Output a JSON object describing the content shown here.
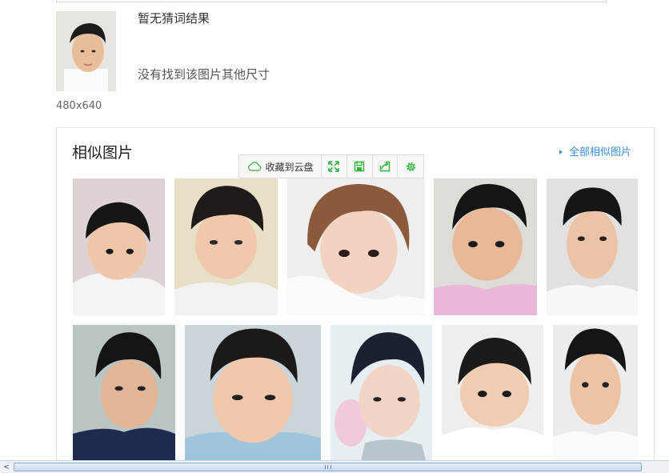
{
  "query": {
    "guess_text": "暂无猜词结果",
    "no_size_text": "没有找到该图片其他尺寸",
    "size": "480x640"
  },
  "similar": {
    "title": "相似图片",
    "all_link": "全部相似图片"
  },
  "toolbar": {
    "save_label": "收藏到云盘",
    "icons": [
      "fullscreen-icon",
      "save-icon",
      "share-icon",
      "settings-icon"
    ],
    "accent": "#2db336"
  },
  "scrollbar": {
    "left_arrow": "<"
  },
  "colors": {
    "link": "#3d8ee6",
    "border": "#e3e3e3"
  }
}
